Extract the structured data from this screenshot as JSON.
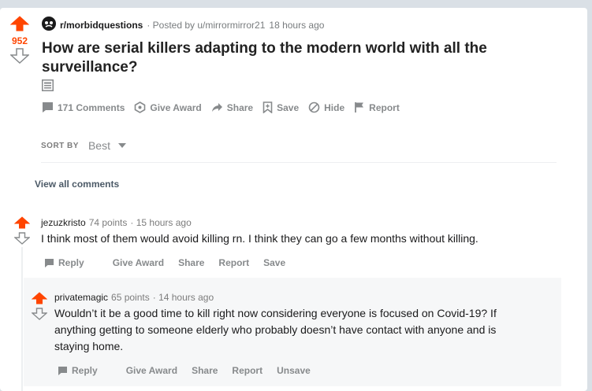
{
  "post": {
    "score": "952",
    "subreddit": "r/morbidquestions",
    "posted_by": "· Posted by u/mirrormirror21",
    "time": "18 hours ago",
    "title": "How are serial killers adapting to the modern world with all the surveillance?",
    "actions": {
      "comments": "171 Comments",
      "award": "Give Award",
      "share": "Share",
      "save": "Save",
      "hide": "Hide",
      "report": "Report"
    }
  },
  "sort": {
    "label": "SORT BY",
    "value": "Best"
  },
  "view_all": "View all comments",
  "comments": [
    {
      "author": "jezuzkristo",
      "points": "74 points",
      "time": "· 15 hours ago",
      "body": "I think most of them would avoid killing rn. I think they can go a few months without killing.",
      "actions": {
        "reply": "Reply",
        "award": "Give Award",
        "share": "Share",
        "report": "Report",
        "save": "Save"
      }
    },
    {
      "author": "privatemagic",
      "points": "65 points",
      "time": "· 14 hours ago",
      "body_lines": [
        "Wouldn’t it be a good time to kill right now considering everyone is focused on Covid-19? If",
        "anything getting to someone elderly who probably doesn’t have contact with anyone and is",
        "staying home."
      ],
      "actions": {
        "reply": "Reply",
        "award": "Give Award",
        "share": "Share",
        "report": "Report",
        "save": "Unsave"
      }
    }
  ],
  "colors": {
    "accent": "#ff4500",
    "muted": "#878a8c",
    "background": "#dae0e6"
  }
}
